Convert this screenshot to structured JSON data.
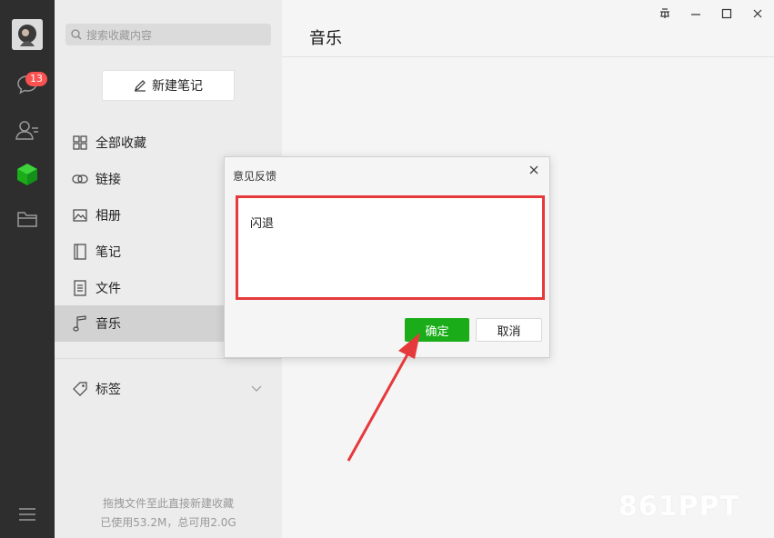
{
  "rail": {
    "badge_count": "13",
    "icons": [
      "chat-icon",
      "contacts-icon",
      "favorites-cube-icon",
      "folder-icon",
      "menu-icon"
    ]
  },
  "sidebar": {
    "search_placeholder": "搜索收藏内容",
    "new_note_label": "新建笔记",
    "items": [
      {
        "label": "全部收藏",
        "icon": "grid-icon"
      },
      {
        "label": "链接",
        "icon": "link-icon"
      },
      {
        "label": "相册",
        "icon": "image-icon"
      },
      {
        "label": "笔记",
        "icon": "notebook-icon"
      },
      {
        "label": "文件",
        "icon": "file-icon"
      },
      {
        "label": "音乐",
        "icon": "music-icon"
      }
    ],
    "tags_label": "标签",
    "footer_line1": "拖拽文件至此直接新建收藏",
    "footer_line2": "已使用53.2M，总可用2.0G"
  },
  "main": {
    "title": "音乐"
  },
  "dialog": {
    "title": "意见反馈",
    "feedback_text": "闪退",
    "ok_label": "确定",
    "cancel_label": "取消"
  },
  "watermark": "861PPT",
  "colors": {
    "accent_green": "#1aad19",
    "highlight_red": "#e6393b",
    "badge_red": "#fa5151",
    "rail_bg": "#2e2e2e"
  }
}
